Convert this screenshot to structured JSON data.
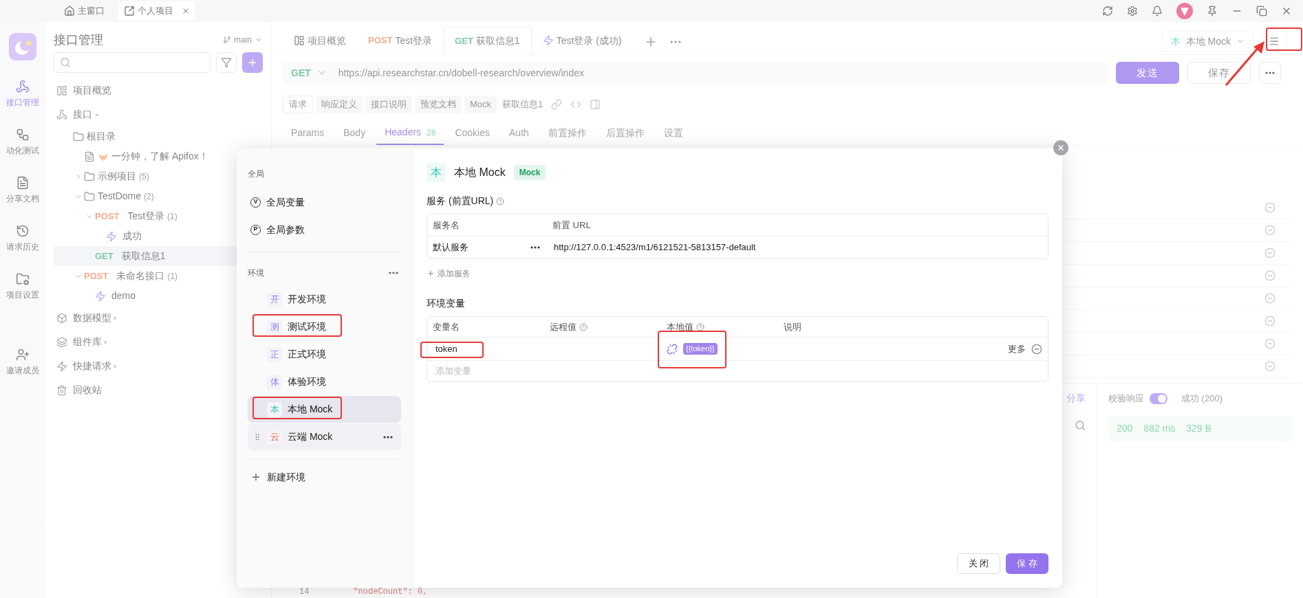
{
  "title_bar": {
    "tabs": [
      {
        "kind": "home",
        "label": "主窗口",
        "selected": false
      },
      {
        "kind": "project",
        "label": "个人项目",
        "selected": true
      }
    ]
  },
  "rail": {
    "items": [
      {
        "kind": "api",
        "label": "接口管理",
        "selected": true
      },
      {
        "kind": "test",
        "label": "动化测试",
        "selected": false
      },
      {
        "kind": "docs",
        "label": "分享文档",
        "selected": false
      },
      {
        "kind": "history",
        "label": "请求历史",
        "selected": false
      },
      {
        "kind": "settings",
        "label": "项目设置",
        "selected": false
      },
      {
        "kind": "invite",
        "label": "邀请成员",
        "selected": false
      }
    ]
  },
  "sidebar": {
    "title": "接口管理",
    "branch": "main",
    "items": [
      {
        "kind": "overview",
        "label": "项目概览"
      },
      {
        "kind": "api",
        "label": "接口",
        "expanded": true,
        "children": [
          {
            "kind": "folder",
            "label": "根目录",
            "children": [
              {
                "kind": "doc",
                "label": "一分钟，了解 Apifox！"
              },
              {
                "kind": "folder",
                "label": "示例项目",
                "count": "(5)",
                "expanded": false
              },
              {
                "kind": "folder",
                "label": "TestDome",
                "count": "(2)",
                "expanded": true,
                "children": [
                  {
                    "kind": "request",
                    "method": "POST",
                    "label": "Test登录",
                    "count": "(1)",
                    "expanded": true,
                    "children": [
                      {
                        "kind": "case",
                        "label": "成功"
                      }
                    ]
                  },
                  {
                    "kind": "request",
                    "method": "GET",
                    "label": "获取信息1",
                    "selected": true
                  }
                ]
              },
              {
                "kind": "request",
                "method": "POST",
                "label": "未命名接口",
                "count": "(1)",
                "expanded": true,
                "children": [
                  {
                    "kind": "case",
                    "label": "demo"
                  }
                ]
              }
            ]
          }
        ]
      },
      {
        "kind": "models",
        "label": "数据模型",
        "expanded": false
      },
      {
        "kind": "components",
        "label": "组件库",
        "expanded": false
      },
      {
        "kind": "quick",
        "label": "快捷请求",
        "expanded": false
      },
      {
        "kind": "trash",
        "label": "回收站"
      }
    ]
  },
  "main": {
    "tabs": [
      {
        "kind": "overview",
        "label": "项目概览",
        "selected": false
      },
      {
        "kind": "request",
        "method": "POST",
        "label": "Test登录",
        "selected": false
      },
      {
        "kind": "request",
        "method": "GET",
        "label": "获取信息1",
        "selected": true
      },
      {
        "kind": "case",
        "label": "Test登录 (成功)",
        "selected": false
      }
    ],
    "env": {
      "badge": "本",
      "name": "本地 Mock"
    },
    "menu_highlighted": true,
    "request": {
      "method": "GET",
      "url": "https://api.researchstar.cn/dobell-research/overview/index",
      "send": "发送",
      "save": "保存"
    },
    "subtabs": [
      {
        "label": "请求",
        "selected": true
      },
      {
        "label": "响应定义",
        "selected": false
      },
      {
        "label": "接口说明",
        "selected": false
      },
      {
        "label": "预览文档",
        "selected": false
      },
      {
        "label": "Mock",
        "selected": false
      }
    ],
    "api_name": "获取信息1",
    "param_tabs": [
      {
        "label": "Params",
        "selected": false
      },
      {
        "label": "Body",
        "selected": false
      },
      {
        "label": "Headers",
        "count": "26",
        "selected": true
      },
      {
        "label": "Cookies",
        "selected": false
      },
      {
        "label": "Auth",
        "selected": false
      },
      {
        "label": "前置操作",
        "selected": false
      },
      {
        "label": "后置操作",
        "selected": false
      },
      {
        "label": "设置",
        "selected": false
      }
    ]
  },
  "response": {
    "share": "分享",
    "validate": {
      "label": "校验响应",
      "on": true
    },
    "status": "成功 (200)",
    "metrics": [
      "200",
      "882 ms",
      "329 B"
    ],
    "code": [
      {
        "line": "14",
        "text": "\"nodeCount\": 0,"
      }
    ]
  },
  "dialog": {
    "global_heading": "全局",
    "globals": [
      {
        "mark": "V",
        "label": "全局变量"
      },
      {
        "mark": "P",
        "label": "全局参数"
      }
    ],
    "env_heading": "环境",
    "envs": [
      {
        "badge": "开",
        "label": "开发环境",
        "color": "#9b7cf0",
        "selected": false,
        "hovered": false,
        "highlighted": false
      },
      {
        "badge": "测",
        "label": "测试环境",
        "color": "#9b7cf0",
        "selected": false,
        "hovered": false,
        "highlighted": true
      },
      {
        "badge": "正",
        "label": "正式环境",
        "color": "#9b7cf0",
        "selected": false,
        "hovered": false,
        "highlighted": false
      },
      {
        "badge": "体",
        "label": "体验环境",
        "color": "#9b7cf0",
        "selected": false,
        "hovered": false,
        "highlighted": false
      },
      {
        "badge": "本",
        "label": "本地 Mock",
        "color": "#2dc7b6",
        "selected": true,
        "hovered": false,
        "highlighted": true
      },
      {
        "badge": "云",
        "label": "云端 Mock",
        "color": "#f0643c",
        "selected": false,
        "hovered": true,
        "highlighted": false
      }
    ],
    "new_env": "新建环境",
    "current": {
      "badge": "本",
      "name": "本地 Mock",
      "color": "#2dc7b6",
      "tag": "Mock"
    },
    "services": {
      "label": "服务 (前置URL)",
      "columns": [
        "服务名",
        "前置 URL"
      ],
      "rows": [
        {
          "name": "默认服务",
          "url": "http://127.0.0.1:4523/m1/6121521-5813157-default"
        }
      ],
      "add": "添加服务"
    },
    "variables": {
      "label": "环境变量",
      "columns": [
        {
          "label": "变量名",
          "help": false
        },
        {
          "label": "远程值",
          "help": true
        },
        {
          "label": "本地值",
          "help": true
        },
        {
          "label": "说明",
          "help": false
        }
      ],
      "rows": [
        {
          "name": "token",
          "name_highlighted": true,
          "local": "{{token}}",
          "local_highlighted": true,
          "more": "更多"
        }
      ],
      "placeholder": "添加变量"
    },
    "buttons": [
      {
        "kind": "secondary",
        "label": "关 闭"
      },
      {
        "kind": "primary",
        "label": "保 存"
      }
    ]
  }
}
